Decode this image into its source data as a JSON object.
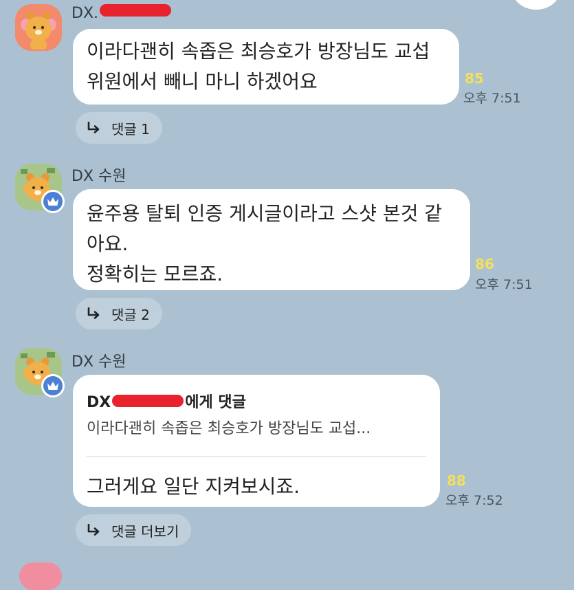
{
  "messages": [
    {
      "sender": "DX",
      "sender_suffix": ".",
      "lines": [
        "이라다괜히 속좁은 최승호가 방장님도 교섭",
        "위원에서 빼니 마니 하겠어요"
      ],
      "read_count": "85",
      "time": "오후 7:51",
      "reply_label": "댓글 1"
    },
    {
      "sender": "DX 수원",
      "lines": [
        "윤주용 탈퇴 인증 게시글이라고 스샷 본것 같",
        "아요.",
        "정확히는 모르죠."
      ],
      "read_count": "86",
      "time": "오후 7:51",
      "reply_label": "댓글 2"
    },
    {
      "sender": "DX 수원",
      "quote_prefix": "DX",
      "quote_suffix": "에게 댓글",
      "quote_text": "이라다괜히 속좁은 최승호가 방장님도 교섭...",
      "lines": [
        "그러게요 일단 지켜보시죠."
      ],
      "read_count": "88",
      "time": "오후 7:52",
      "reply_label": "댓글 더보기"
    }
  ],
  "icons": {
    "avatar": "ryan-character-icon",
    "crown": "crown-icon",
    "reply_arrow": "reply-arrow-icon"
  },
  "colors": {
    "background": "#abc1d1",
    "bubble": "#ffffff",
    "read_count": "#f5e05a",
    "admin_badge": "#4d7fd4",
    "redaction": "#e8232d"
  }
}
